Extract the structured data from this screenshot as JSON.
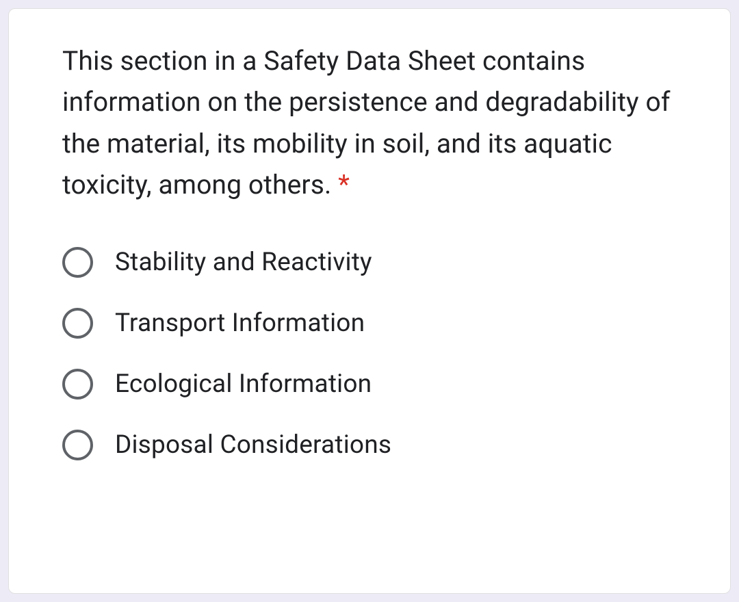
{
  "question": {
    "text": "This section in a Safety Data Sheet contains information on the persistence and degradability of the material, its mobility in soil, and its aquatic toxicity, among others.",
    "required_marker": "*"
  },
  "options": [
    {
      "label": "Stability and Reactivity"
    },
    {
      "label": "Transport Information"
    },
    {
      "label": "Ecological Information"
    },
    {
      "label": "Disposal Considerations"
    }
  ]
}
